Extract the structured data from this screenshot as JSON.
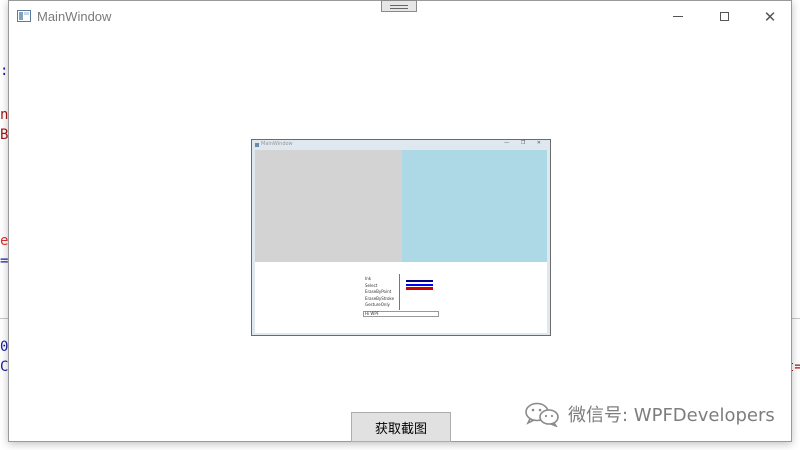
{
  "window": {
    "title": "MainWindow",
    "controls": {
      "minimize": "minimize",
      "maximize": "maximize",
      "close": "✕"
    }
  },
  "background_fragments": [
    ":",
    "n",
    "B",
    "e",
    "=",
    "0",
    "C",
    "t="
  ],
  "preview": {
    "title": "MainWindow",
    "controls": "— ❐ ✕",
    "list_items": [
      "Ink",
      "Select",
      "EraseByPoint",
      "EraseByStroke",
      "GestureOnly"
    ],
    "stroke_colors": [
      "#000080",
      "#0000ff",
      "#cc0000"
    ],
    "input_text": "Hi WPF"
  },
  "capture_button": {
    "label": "获取截图"
  },
  "watermark": {
    "text": "微信号: WPFDevelopers",
    "icon": "wechat-icon"
  },
  "colors": {
    "gray_area": "#d3d3d3",
    "blue_area": "#add8e6",
    "button_bg": "#e1e1e1"
  }
}
